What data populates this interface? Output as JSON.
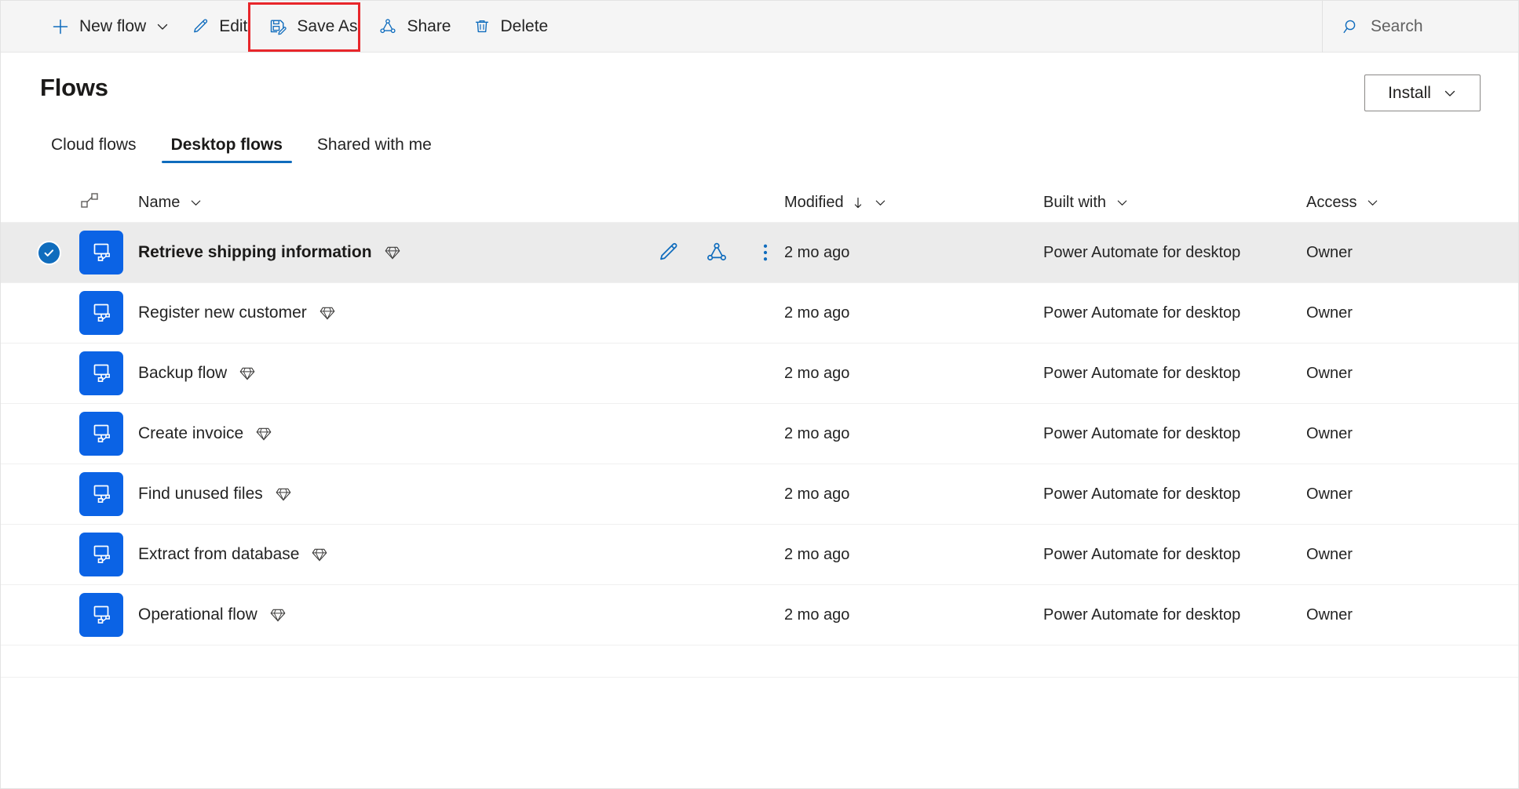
{
  "toolbar": {
    "items": [
      {
        "id": "new-flow",
        "label": "New flow",
        "icon": "plus-icon",
        "chevron": true
      },
      {
        "id": "edit",
        "label": "Edit",
        "icon": "pencil-icon",
        "chevron": false
      },
      {
        "id": "save-as",
        "label": "Save As",
        "icon": "save-as-icon",
        "chevron": false,
        "highlighted": true
      },
      {
        "id": "share",
        "label": "Share",
        "icon": "share-icon",
        "chevron": false
      },
      {
        "id": "delete",
        "label": "Delete",
        "icon": "trash-icon",
        "chevron": false
      }
    ],
    "search": {
      "placeholder": "Search",
      "icon": "search-icon"
    }
  },
  "header": {
    "title": "Flows",
    "install_label": "Install",
    "install_icon": "chevron-down-icon"
  },
  "tabs": [
    {
      "label": "Cloud flows",
      "active": false
    },
    {
      "label": "Desktop flows",
      "active": true
    },
    {
      "label": "Shared with me",
      "active": false
    }
  ],
  "table": {
    "columns": {
      "flow_icon_header": "flow-connector-icon",
      "name": "Name",
      "modified": "Modified",
      "modified_sort": "↓",
      "built_with": "Built with",
      "access": "Access"
    },
    "row_actions": [
      {
        "id": "edit",
        "icon": "pencil-icon"
      },
      {
        "id": "share",
        "icon": "share-icon"
      },
      {
        "id": "more",
        "icon": "more-vertical-icon"
      }
    ],
    "rows": [
      {
        "name": "Retrieve shipping information",
        "premium": true,
        "modified": "2 mo ago",
        "built_with": "Power Automate for desktop",
        "access": "Owner",
        "selected": true
      },
      {
        "name": "Register new customer",
        "premium": true,
        "modified": "2 mo ago",
        "built_with": "Power Automate for desktop",
        "access": "Owner",
        "selected": false
      },
      {
        "name": "Backup flow",
        "premium": true,
        "modified": "2 mo ago",
        "built_with": "Power Automate for desktop",
        "access": "Owner",
        "selected": false
      },
      {
        "name": "Create invoice",
        "premium": true,
        "modified": "2 mo ago",
        "built_with": "Power Automate for desktop",
        "access": "Owner",
        "selected": false
      },
      {
        "name": "Find unused files",
        "premium": true,
        "modified": "2 mo ago",
        "built_with": "Power Automate for desktop",
        "access": "Owner",
        "selected": false
      },
      {
        "name": "Extract from database",
        "premium": true,
        "modified": "2 mo ago",
        "built_with": "Power Automate for desktop",
        "access": "Owner",
        "selected": false
      },
      {
        "name": "Operational flow",
        "premium": true,
        "modified": "2 mo ago",
        "built_with": "Power Automate for desktop",
        "access": "Owner",
        "selected": false
      }
    ]
  },
  "colors": {
    "accent": "#0f6cbd",
    "tile_blue": "#0b63e5",
    "highlight_red": "#e8262b",
    "commandbar_bg": "#f5f5f5",
    "selected_row_bg": "#ebebeb"
  }
}
